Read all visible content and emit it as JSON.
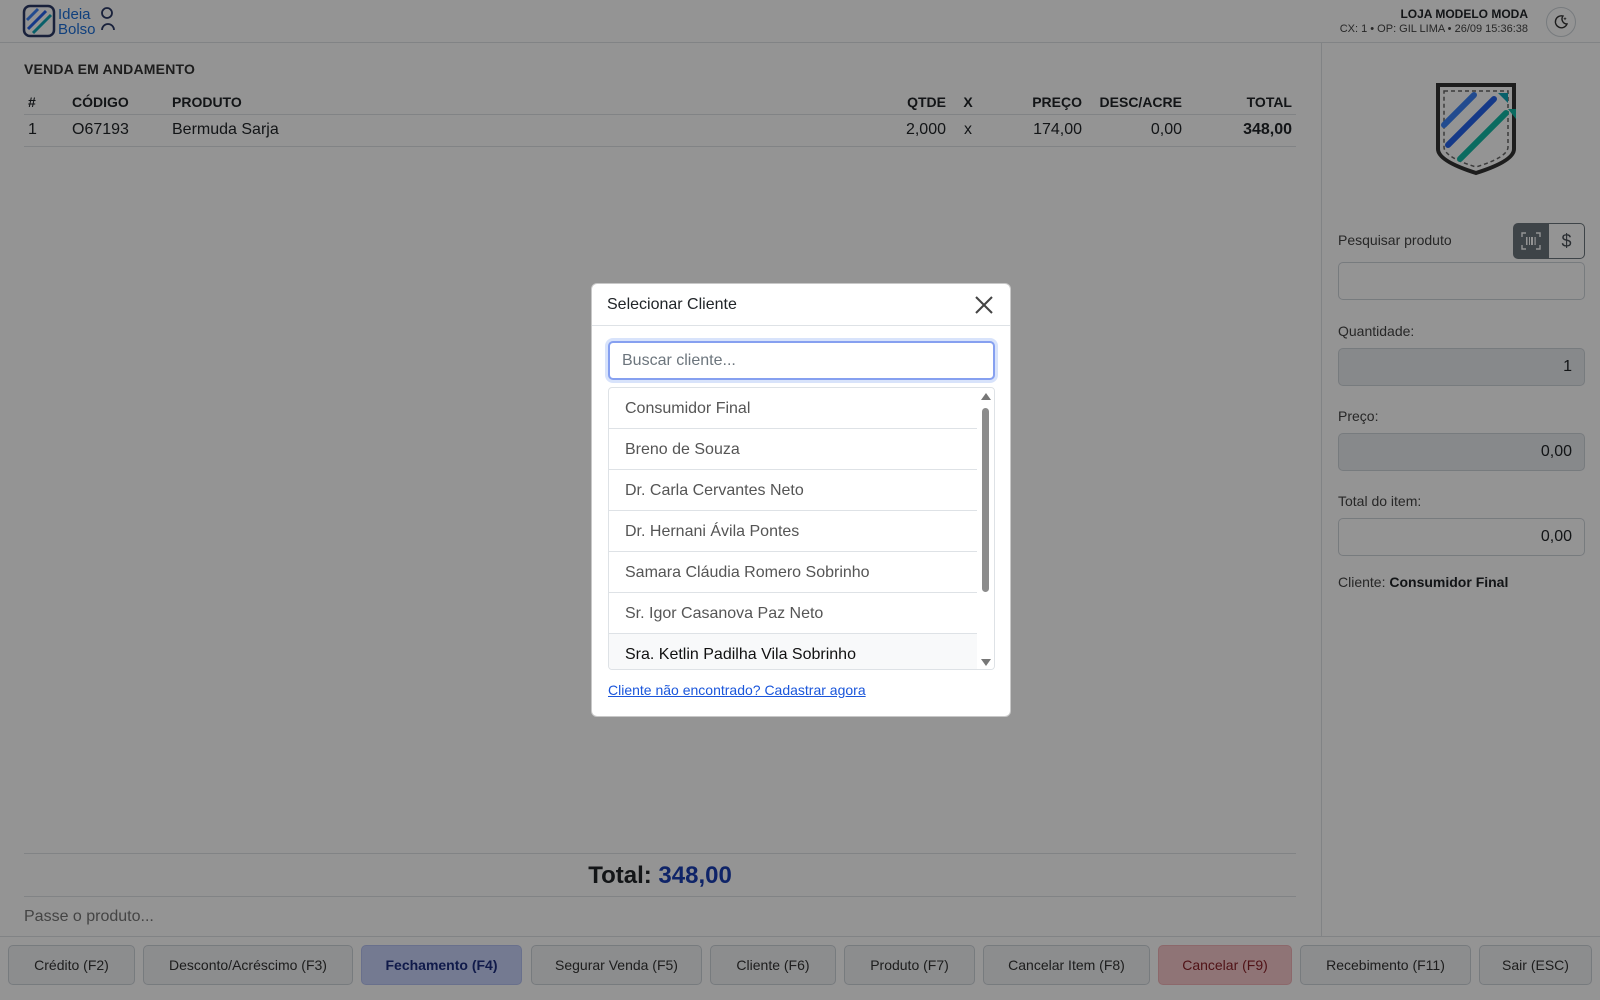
{
  "header": {
    "logo_text_top": "Ideia",
    "logo_text_bottom": "Bolso",
    "store_name": "LOJA MODELO MODA",
    "store_meta": "CX: 1 • OP: GIL LIMA • 26/09 15:36:38"
  },
  "sale": {
    "title": "VENDA EM ANDAMENTO",
    "columns": [
      "#",
      "CÓDIGO",
      "PRODUTO",
      "QTDE",
      "X",
      "PREÇO",
      "DESC/ACRE",
      "TOTAL"
    ],
    "rows": [
      {
        "n": "1",
        "code": "O67193",
        "product": "Bermuda Sarja",
        "qty": "2,000",
        "x": "x",
        "price": "174,00",
        "disc": "0,00",
        "total": "348,00"
      }
    ],
    "total_label": "Total:",
    "total_value": "348,00",
    "scan_placeholder": "Passe o produto..."
  },
  "side": {
    "search_label": "Pesquisar produto",
    "dollar_symbol": "$",
    "qty_label": "Quantidade:",
    "qty_value": "1",
    "price_label": "Preço:",
    "price_value": "0,00",
    "item_total_label": "Total do item:",
    "item_total_value": "0,00",
    "client_label": "Cliente:",
    "client_value": "Consumidor Final"
  },
  "footer": {
    "buttons": [
      {
        "label": "Crédito (F2)"
      },
      {
        "label": "Desconto/Acréscimo (F3)"
      },
      {
        "label": "Fechamento (F4)"
      },
      {
        "label": "Segurar Venda (F5)"
      },
      {
        "label": "Cliente (F6)"
      },
      {
        "label": "Produto (F7)"
      },
      {
        "label": "Cancelar Item (F8)"
      },
      {
        "label": "Cancelar (F9)"
      },
      {
        "label": "Recebimento (F11)"
      },
      {
        "label": "Sair (ESC)"
      }
    ]
  },
  "modal": {
    "title": "Selecionar Cliente",
    "search_placeholder": "Buscar cliente...",
    "clients": [
      "Consumidor Final",
      "Breno de Souza",
      "Dr. Carla Cervantes Neto",
      "Dr. Hernani Ávila Pontes",
      "Samara Cláudia Romero Sobrinho",
      "Sr. Igor Casanova Paz Neto",
      "Sra. Ketlin Padilha Vila Sobrinho"
    ],
    "register_link": "Cliente não encontrado? Cadastrar agora"
  },
  "colors": {
    "accent": "#1a3fb3",
    "primary_button": "#c9d3fa",
    "danger_button": "#f6c9cc",
    "link": "#1a56db"
  },
  "icons": [
    "logo-icon",
    "moon-icon",
    "barcode-icon",
    "dollar-icon",
    "close-icon"
  ]
}
